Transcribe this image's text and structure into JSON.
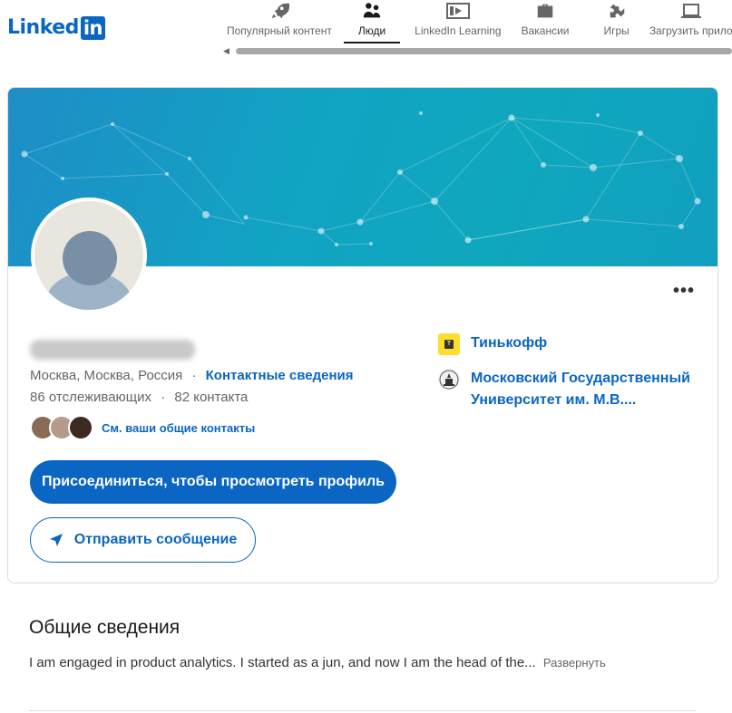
{
  "header": {
    "logo_text": "Linked",
    "logo_in": "in",
    "nav": [
      {
        "label": "Популярный контент",
        "icon": "rocket-icon"
      },
      {
        "label": "Люди",
        "icon": "people-icon",
        "active": true
      },
      {
        "label": "LinkedIn Learning",
        "icon": "learning-icon"
      },
      {
        "label": "Вакансии",
        "icon": "briefcase-icon"
      },
      {
        "label": "Игры",
        "icon": "puzzle-icon"
      },
      {
        "label": "Загрузить прило",
        "icon": "laptop-icon"
      }
    ]
  },
  "profile": {
    "location": "Москва, Москва, Россия",
    "separator": "·",
    "contact_info_link": "Контактные сведения",
    "followers": "86 отслеживающих",
    "connections": "82 контакта",
    "mutual_link": "См. ваши общие контакты",
    "join_button": "Присоединиться, чтобы просмотреть профиль",
    "message_button": "Отправить сообщение",
    "more_label": "•••",
    "orgs": [
      {
        "name": "Тинькофф",
        "icon": "tinkoff-logo-icon"
      },
      {
        "name": "Московский Государственный Университет им. М.В....",
        "icon": "msu-logo-icon"
      }
    ]
  },
  "about": {
    "title": "Общие сведения",
    "text": "I am engaged in product analytics. I started as a jun, and now I am the head of the...",
    "expand": "Развернуть"
  },
  "colors": {
    "brand": "#0a66c2",
    "banner": "#12a3c3",
    "tinkoff": "#ffdd2d"
  }
}
